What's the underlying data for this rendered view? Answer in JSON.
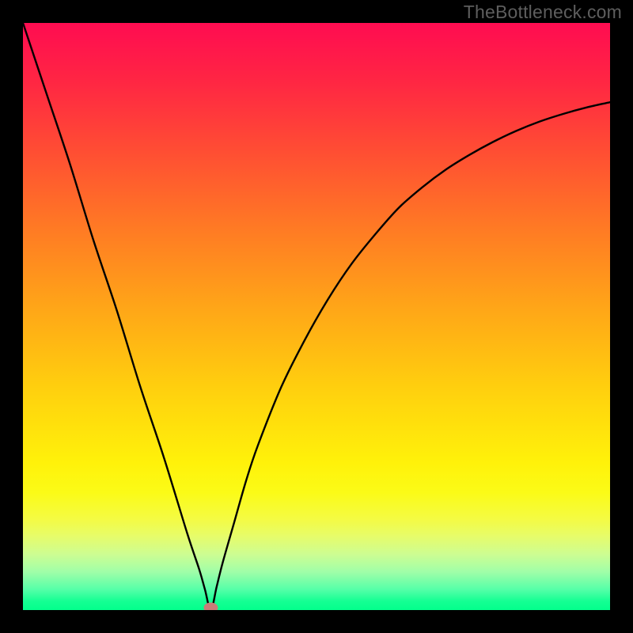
{
  "watermark": "TheBottleneck.com",
  "chart_data": {
    "type": "line",
    "title": "",
    "xlabel": "",
    "ylabel": "",
    "xlim": [
      0,
      100
    ],
    "ylim": [
      0,
      100
    ],
    "minimum_x": 32,
    "series": [
      {
        "name": "bottleneck-curve",
        "x": [
          0,
          4,
          8,
          12,
          16,
          20,
          24,
          28,
          30,
          31,
          32,
          33,
          34,
          36,
          38,
          40,
          44,
          48,
          52,
          56,
          60,
          64,
          68,
          72,
          76,
          80,
          84,
          88,
          92,
          96,
          100
        ],
        "y": [
          100,
          88,
          76,
          63,
          51,
          38,
          26,
          13,
          7,
          3.5,
          0,
          4,
          8,
          15,
          22,
          28,
          38,
          46,
          53,
          59,
          64,
          68.5,
          72,
          75,
          77.5,
          79.7,
          81.6,
          83.2,
          84.5,
          85.6,
          86.5
        ]
      }
    ],
    "gradient_stops": [
      {
        "offset": 0.0,
        "color": "#ff0c51"
      },
      {
        "offset": 0.1,
        "color": "#ff2643"
      },
      {
        "offset": 0.22,
        "color": "#ff4e33"
      },
      {
        "offset": 0.35,
        "color": "#ff7a24"
      },
      {
        "offset": 0.48,
        "color": "#ffa418"
      },
      {
        "offset": 0.62,
        "color": "#ffcf0e"
      },
      {
        "offset": 0.75,
        "color": "#fff20a"
      },
      {
        "offset": 0.8,
        "color": "#fbfb17"
      },
      {
        "offset": 0.845,
        "color": "#f4fb43"
      },
      {
        "offset": 0.875,
        "color": "#e6fc6b"
      },
      {
        "offset": 0.905,
        "color": "#cdfd92"
      },
      {
        "offset": 0.935,
        "color": "#a0fea8"
      },
      {
        "offset": 0.965,
        "color": "#55ffa8"
      },
      {
        "offset": 0.985,
        "color": "#14ff93"
      },
      {
        "offset": 1.0,
        "color": "#03ff8c"
      }
    ],
    "marker": {
      "x": 32,
      "y": 0,
      "color": "#c97d78"
    }
  }
}
